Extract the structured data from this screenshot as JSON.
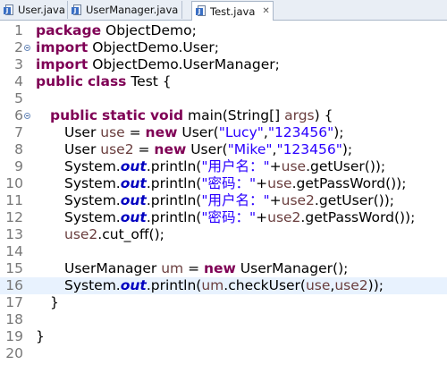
{
  "tabs": [
    {
      "label": "User.java",
      "active": false,
      "icon": "java-file-icon"
    },
    {
      "label": "UserManager.java",
      "active": false,
      "icon": "java-file-icon"
    },
    {
      "label": "Test.java",
      "active": true,
      "icon": "java-file-icon",
      "close": "✕"
    }
  ],
  "line_numbers": [
    "1",
    "2",
    "3",
    "4",
    "5",
    "6",
    "7",
    "8",
    "9",
    "10",
    "11",
    "12",
    "13",
    "14",
    "15",
    "16",
    "17",
    "18",
    "19",
    "20"
  ],
  "code": {
    "l1": {
      "kw": "package",
      "rest": " ObjectDemo;"
    },
    "l2": {
      "kw": "import",
      "rest": " ObjectDemo.User;"
    },
    "l3": {
      "kw": "import",
      "rest": " ObjectDemo.UserManager;"
    },
    "l4": {
      "kw1": "public",
      "kw2": "class",
      "rest": " Test {"
    },
    "l6": {
      "kw1": "public",
      "kw2": "static",
      "kw3": "void",
      "rest": " main(String[] ",
      "var": "args",
      "end": ") {"
    },
    "l7": {
      "a": "User ",
      "var": "use",
      "b": " = ",
      "kw": "new",
      "c": " User(",
      "s1": "\"Lucy\"",
      "d": ",",
      "s2": "\"123456\"",
      "e": ");"
    },
    "l8": {
      "a": "User ",
      "var": "use2",
      "b": " = ",
      "kw": "new",
      "c": " User(",
      "s1": "\"Mike\"",
      "d": ",",
      "s2": "\"123456\"",
      "e": ");"
    },
    "l9": {
      "a": "System.",
      "fld": "out",
      "b": ".println(",
      "s": "\"用户名：\"",
      "c": "+",
      "var": "use",
      "d": ".getUser());"
    },
    "l10": {
      "a": "System.",
      "fld": "out",
      "b": ".println(",
      "s": "\"密码：\"",
      "c": "+",
      "var": "use",
      "d": ".getPassWord());"
    },
    "l11": {
      "a": "System.",
      "fld": "out",
      "b": ".println(",
      "s": "\"用户名：\"",
      "c": "+",
      "var": "use2",
      "d": ".getUser());"
    },
    "l12": {
      "a": "System.",
      "fld": "out",
      "b": ".println(",
      "s": "\"密码：\"",
      "c": "+",
      "var": "use2",
      "d": ".getPassWord());"
    },
    "l13": {
      "var": "use2",
      "a": ".cut_off();"
    },
    "l15": {
      "a": "UserManager ",
      "var": "um",
      "b": " = ",
      "kw": "new",
      "c": " UserManager();"
    },
    "l16": {
      "a": "System.",
      "fld": "out",
      "b": ".println(",
      "var1": "um",
      "c": ".checkUser(",
      "var2": "use",
      "d": ",",
      "var3": "use2",
      "e": "));"
    },
    "l17": {
      "a": "}"
    },
    "l19": {
      "a": "}"
    }
  },
  "colors": {
    "keyword": "#7f0055",
    "string": "#2a00ff",
    "local_var": "#6a3e3e",
    "static_field": "#0000c0",
    "current_line": "#e8f2fe"
  }
}
